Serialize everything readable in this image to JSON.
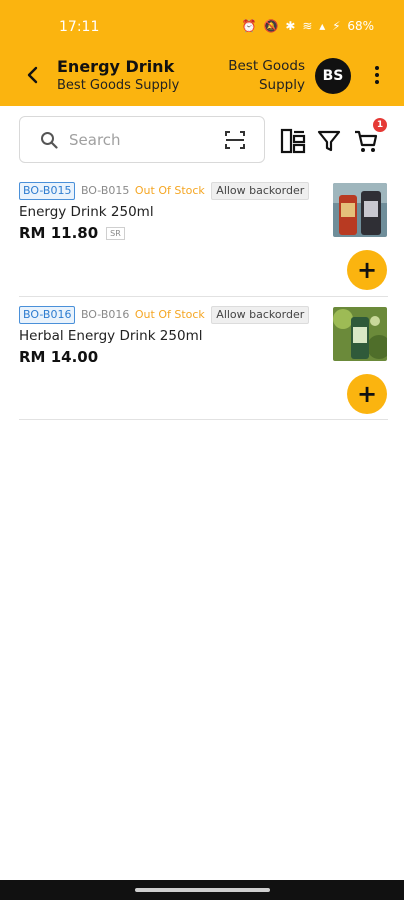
{
  "status_bar": {
    "time": "17:11",
    "battery": "68%",
    "icons": [
      "alarm-icon",
      "mute-icon",
      "bluetooth-icon",
      "wifi-icon",
      "signal-icon",
      "charging-icon"
    ]
  },
  "header": {
    "title": "Energy Drink",
    "subtitle": "Best Goods Supply",
    "supplier_line1": "Best Goods",
    "supplier_line2": "Supply",
    "avatar_initials": "BS",
    "background_color": "#FBB40F"
  },
  "toolbar": {
    "search_placeholder": "Search",
    "search_value": "",
    "cart_count": "1"
  },
  "products": [
    {
      "sku_chip": "BO-B015",
      "sku": "BO-B015",
      "stock_status": "Out Of Stock",
      "backorder": "Allow backorder",
      "name": "Energy Drink 250ml",
      "price": "RM 11.80",
      "tax_tag": "SR",
      "add_label": "+"
    },
    {
      "sku_chip": "BO-B016",
      "sku": "BO-B016",
      "stock_status": "Out Of Stock",
      "backorder": "Allow backorder",
      "name": "Herbal Energy Drink 250ml",
      "price": "RM 14.00",
      "tax_tag": "",
      "add_label": "+"
    }
  ],
  "colors": {
    "accent": "#FBB40F",
    "stock_warning": "#F5A623",
    "sku_chip": "#2f7dd0",
    "badge": "#e53935"
  }
}
